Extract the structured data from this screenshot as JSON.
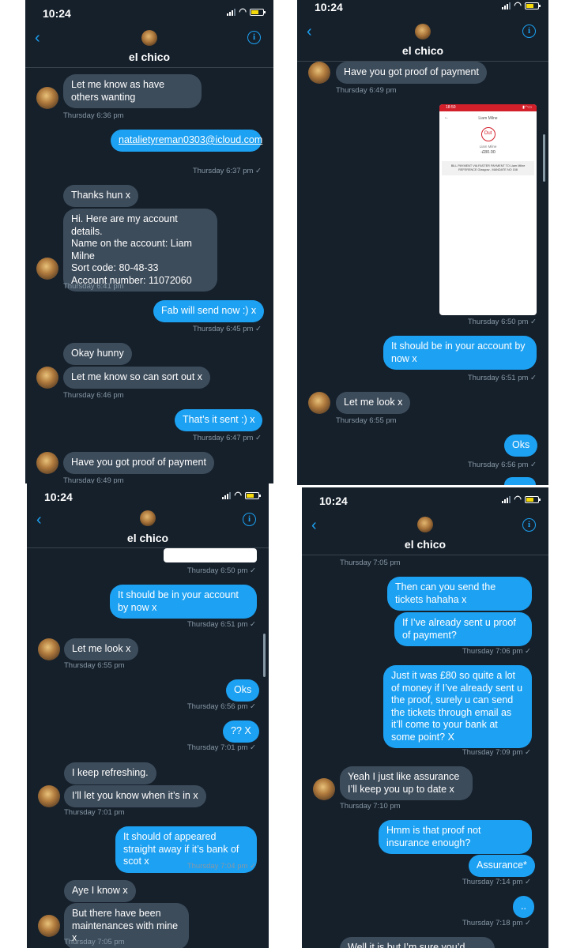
{
  "status_time": "10:24",
  "chat_name": "el chico",
  "colors": {
    "background": "#15202b",
    "incoming": "#3d4c5b",
    "outgoing": "#1da1f2",
    "timestamp": "#8899a6"
  },
  "icons": {
    "back": "chevron-left-icon",
    "info": "info-circle-icon",
    "signal": "signal-icon",
    "wifi": "wifi-icon",
    "battery": "battery-charging-icon"
  },
  "panel1": {
    "m1": "Let me know as have others wanting",
    "t1": "Thursday 6:36 pm",
    "m2": "natalietyreman0303@icloud.com",
    "t2": "Thursday 6:37 pm ✓",
    "m3": "Thanks hun x",
    "m4_lines": [
      "Hi. Here are my account details.",
      "Name on the account: Liam Milne",
      "Sort code: 80-48-33",
      "Account number: 11072060"
    ],
    "t3": "Thursday 6:41 pm",
    "m5": "Fab will send now :) x",
    "t4": "Thursday 6:45 pm ✓",
    "m6": "Okay hunny",
    "m7": "Let me know so can sort out x",
    "t5": "Thursday 6:46 pm",
    "m8": "That’s it sent :) x",
    "t6": "Thursday 6:47 pm ✓",
    "m9": "Have you got proof of payment",
    "t7": "Thursday 6:49 pm"
  },
  "panel2": {
    "m1": "Have you got proof of payment",
    "t1": "Thursday 6:49 pm",
    "shot": {
      "time": "18:50",
      "title": "Liam Milne",
      "badge": "Out",
      "name": "Liam Milne",
      "amount": "-£80.00",
      "reference": "BILL PAYMENT VIA FASTER PAYMENT TO Liam Milne REFERENCE Glasgow , MANDATE NO 158"
    },
    "t2": "Thursday 6:50 pm ✓",
    "m2": "It should be in your account by now x",
    "t3": "Thursday 6:51 pm ✓",
    "m3": "Let me look x",
    "t4": "Thursday 6:55 pm",
    "m4": "Oks",
    "t5": "Thursday 6:56 pm ✓"
  },
  "panel3": {
    "t1": "Thursday 6:50 pm ✓",
    "m1": "It should be in your account by now x",
    "t2": "Thursday 6:51 pm ✓",
    "m2": "Let me look x",
    "t3": "Thursday 6:55 pm",
    "m3": "Oks",
    "t4": "Thursday 6:56 pm ✓",
    "m4": "?? X",
    "t5": "Thursday 7:01 pm ✓",
    "m5": "I keep refreshing.",
    "m6": "I’ll let you know when it’s in x",
    "t6": "Thursday 7:01 pm",
    "m7": "It should of appeared straight away if it’s bank of scot x",
    "t7": "Thursday 7:04 pm ✓",
    "m8": "Aye I know x",
    "m9": "But there have been maintenances with mine x",
    "t8": "Thursday 7:05 pm"
  },
  "panel4": {
    "t1": "Thursday 7:05 pm",
    "m1": "Then can you send the tickets hahaha x",
    "m2": "If I’ve already sent u proof of payment?",
    "t2": "Thursday 7:06 pm ✓",
    "m3": "Just it was £80 so quite a lot of money if I’ve already sent u the proof, surely u can send the tickets through email as it’ll come to your bank at some point? X",
    "t3": "Thursday 7:09 pm ✓",
    "m4": "Yeah I just like assurance I’ll keep you up to date x",
    "t4": "Thursday 7:10 pm",
    "m5": "Hmm is that proof not insurance enough?",
    "m6": "Assurance*",
    "t5": "Thursday 7:14 pm ✓",
    "m7": "..",
    "t6": "Thursday 7:18 pm ✓",
    "m8": "Well it is but I’m sure you’d"
  }
}
